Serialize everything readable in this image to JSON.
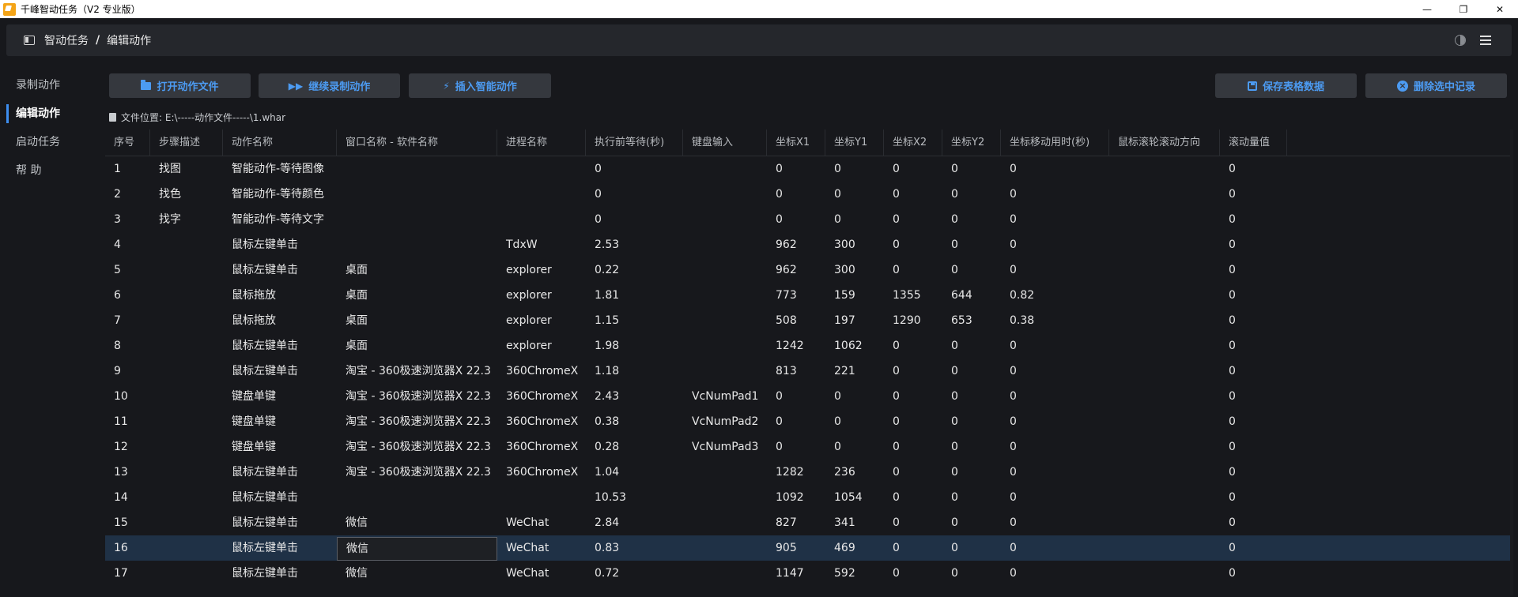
{
  "titlebar": {
    "title": "千峰智动任务（V2 专业版）",
    "min": "—",
    "restore": "❐",
    "close": "✕"
  },
  "header": {
    "crumb_root": "智动任务",
    "crumb_sep": "/",
    "crumb_current": "编辑动作"
  },
  "sidebar": {
    "items": [
      {
        "label": "录制动作"
      },
      {
        "label": "编辑动作"
      },
      {
        "label": "启动任务"
      },
      {
        "label": "帮  助"
      }
    ]
  },
  "toolbar": {
    "open_label": "打开动作文件",
    "continue_label": "继续录制动作",
    "insert_label": "插入智能动作",
    "save_label": "保存表格数据",
    "delete_label": "删除选中记录"
  },
  "file": {
    "location": "文件位置: E:\\-----动作文件-----\\1.whar"
  },
  "table": {
    "headers": [
      "序号",
      "步骤描述",
      "动作名称",
      "窗口名称 - 软件名称",
      "进程名称",
      "执行前等待(秒)",
      "键盘输入",
      "坐标X1",
      "坐标Y1",
      "坐标X2",
      "坐标Y2",
      "坐标移动用时(秒)",
      "鼠标滚轮滚动方向",
      "滚动量值"
    ],
    "rows": [
      [
        "1",
        "找图",
        "智能动作-等待图像",
        "",
        "",
        "0",
        "",
        "0",
        "0",
        "0",
        "0",
        "0",
        "",
        "0"
      ],
      [
        "2",
        "找色",
        "智能动作-等待颜色",
        "",
        "",
        "0",
        "",
        "0",
        "0",
        "0",
        "0",
        "0",
        "",
        "0"
      ],
      [
        "3",
        "找字",
        "智能动作-等待文字",
        "",
        "",
        "0",
        "",
        "0",
        "0",
        "0",
        "0",
        "0",
        "",
        "0"
      ],
      [
        "4",
        "",
        "鼠标左键单击",
        "",
        "TdxW",
        "2.53",
        "",
        "962",
        "300",
        "0",
        "0",
        "0",
        "",
        "0"
      ],
      [
        "5",
        "",
        "鼠标左键单击",
        "桌面",
        "explorer",
        "0.22",
        "",
        "962",
        "300",
        "0",
        "0",
        "0",
        "",
        "0"
      ],
      [
        "6",
        "",
        "鼠标拖放",
        "桌面",
        "explorer",
        "1.81",
        "",
        "773",
        "159",
        "1355",
        "644",
        "0.82",
        "",
        "0"
      ],
      [
        "7",
        "",
        "鼠标拖放",
        "桌面",
        "explorer",
        "1.15",
        "",
        "508",
        "197",
        "1290",
        "653",
        "0.38",
        "",
        "0"
      ],
      [
        "8",
        "",
        "鼠标左键单击",
        "桌面",
        "explorer",
        "1.98",
        "",
        "1242",
        "1062",
        "0",
        "0",
        "0",
        "",
        "0"
      ],
      [
        "9",
        "",
        "鼠标左键单击",
        "淘宝 - 360极速浏览器X 22.3",
        "360ChromeX",
        "1.18",
        "",
        "813",
        "221",
        "0",
        "0",
        "0",
        "",
        "0"
      ],
      [
        "10",
        "",
        "键盘单键",
        "淘宝 - 360极速浏览器X 22.3",
        "360ChromeX",
        "2.43",
        "VcNumPad1",
        "0",
        "0",
        "0",
        "0",
        "0",
        "",
        "0"
      ],
      [
        "11",
        "",
        "键盘单键",
        "淘宝 - 360极速浏览器X 22.3",
        "360ChromeX",
        "0.38",
        "VcNumPad2",
        "0",
        "0",
        "0",
        "0",
        "0",
        "",
        "0"
      ],
      [
        "12",
        "",
        "键盘单键",
        "淘宝 - 360极速浏览器X 22.3",
        "360ChromeX",
        "0.28",
        "VcNumPad3",
        "0",
        "0",
        "0",
        "0",
        "0",
        "",
        "0"
      ],
      [
        "13",
        "",
        "鼠标左键单击",
        "淘宝 - 360极速浏览器X 22.3",
        "360ChromeX",
        "1.04",
        "",
        "1282",
        "236",
        "0",
        "0",
        "0",
        "",
        "0"
      ],
      [
        "14",
        "",
        "鼠标左键单击",
        "",
        "",
        "10.53",
        "",
        "1092",
        "1054",
        "0",
        "0",
        "0",
        "",
        "0"
      ],
      [
        "15",
        "",
        "鼠标左键单击",
        "微信",
        "WeChat",
        "2.84",
        "",
        "827",
        "341",
        "0",
        "0",
        "0",
        "",
        "0"
      ],
      [
        "16",
        "",
        "鼠标左键单击",
        "微信",
        "WeChat",
        "0.83",
        "",
        "905",
        "469",
        "0",
        "0",
        "0",
        "",
        "0"
      ],
      [
        "17",
        "",
        "鼠标左键单击",
        "微信",
        "WeChat",
        "0.72",
        "",
        "1147",
        "592",
        "0",
        "0",
        "0",
        "",
        "0"
      ]
    ]
  }
}
